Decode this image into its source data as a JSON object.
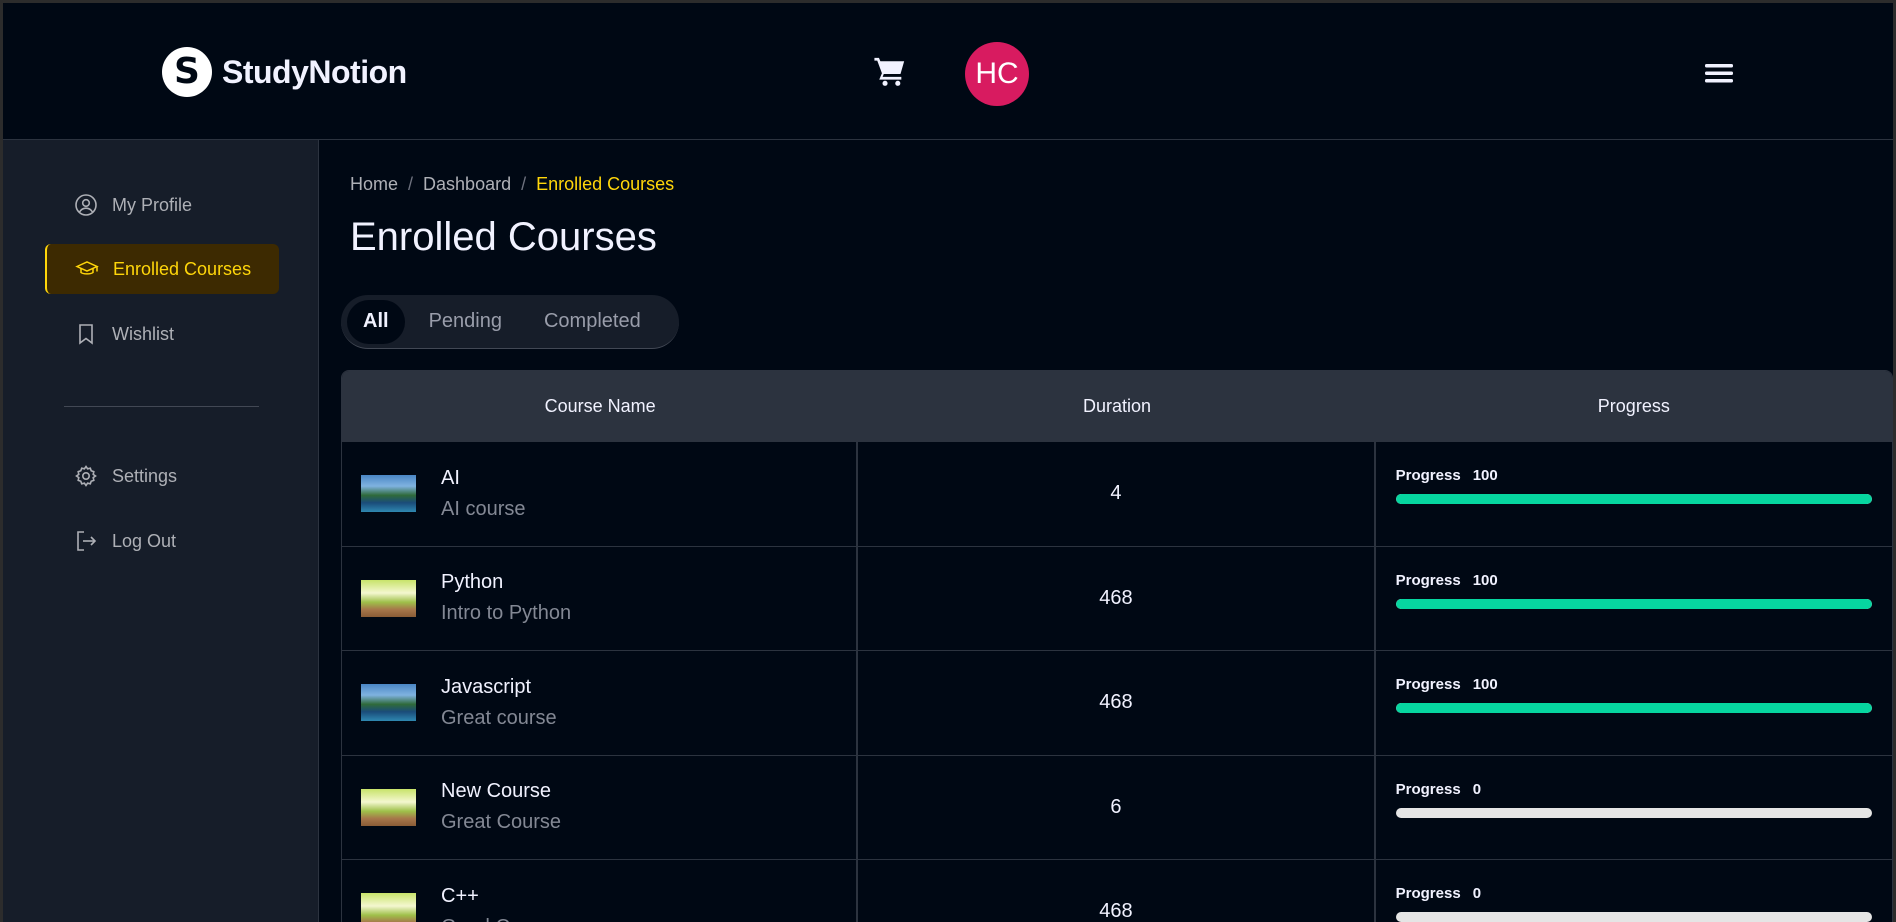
{
  "brand": {
    "name": "StudyNotion",
    "mark": "S"
  },
  "header": {
    "avatar_initials": "HC",
    "cart_icon": "cart-icon",
    "menu_icon": "hamburger-menu-icon"
  },
  "sidebar": {
    "items": [
      {
        "label": "My Profile",
        "icon": "user-circle-icon",
        "active": false
      },
      {
        "label": "Enrolled Courses",
        "icon": "graduation-cap-icon",
        "active": true
      },
      {
        "label": "Wishlist",
        "icon": "bookmark-icon",
        "active": false
      },
      {
        "label": "Settings",
        "icon": "gear-icon",
        "active": false
      },
      {
        "label": "Log Out",
        "icon": "logout-icon",
        "active": false
      }
    ]
  },
  "breadcrumb": {
    "home": "Home",
    "dashboard": "Dashboard",
    "current": "Enrolled Courses",
    "separator": "/"
  },
  "page": {
    "title": "Enrolled Courses"
  },
  "tabs": [
    {
      "label": "All",
      "active": true
    },
    {
      "label": "Pending",
      "active": false
    },
    {
      "label": "Completed",
      "active": false
    }
  ],
  "table": {
    "headers": {
      "course": "Course Name",
      "duration": "Duration",
      "progress": "Progress"
    },
    "progress_label": "Progress",
    "rows": [
      {
        "name": "AI",
        "description": "AI course",
        "duration": "4",
        "progress": 100,
        "progress_text": "100",
        "thumb": "lake"
      },
      {
        "name": "Python",
        "description": "Intro to Python",
        "duration": "468",
        "progress": 100,
        "progress_text": "100",
        "thumb": "forest"
      },
      {
        "name": "Javascript",
        "description": "Great course",
        "duration": "468",
        "progress": 100,
        "progress_text": "100",
        "thumb": "lake"
      },
      {
        "name": "New Course",
        "description": "Great Course",
        "duration": "6",
        "progress": 0,
        "progress_text": "0",
        "thumb": "forest"
      },
      {
        "name": "C++",
        "description": "Good Course",
        "duration": "468",
        "progress": 0,
        "progress_text": "0",
        "thumb": "forest"
      }
    ]
  },
  "colors": {
    "accent": "#ffd60a",
    "progress_fill": "#06d6a0",
    "avatar": "#d81b60",
    "background": "#000814",
    "sidebar": "#161d29"
  }
}
